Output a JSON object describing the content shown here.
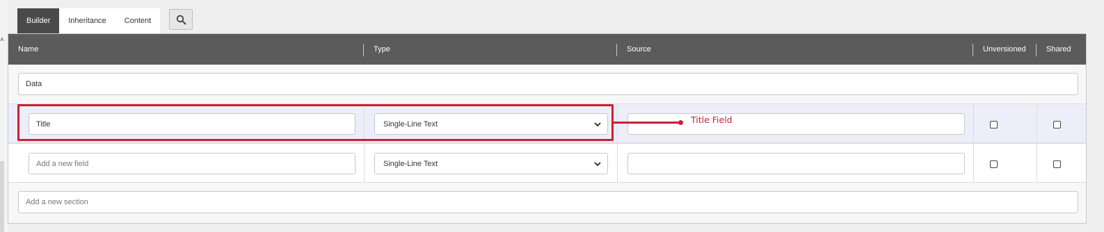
{
  "tabs": [
    {
      "label": "Builder",
      "active": true
    },
    {
      "label": "Inheritance",
      "active": false
    },
    {
      "label": "Content",
      "active": false
    }
  ],
  "search": {
    "icon": "search-icon"
  },
  "grid": {
    "columns": [
      "Name",
      "Type",
      "Source",
      "Unversioned",
      "Shared"
    ],
    "sections": [
      {
        "name": "Data",
        "fields": [
          {
            "name": "Title",
            "type": "Single-Line Text",
            "source": "",
            "unversioned": false,
            "shared": false
          },
          {
            "name_placeholder": "Add a new field",
            "type": "Single-Line Text",
            "source": "",
            "unversioned": false,
            "shared": false
          }
        ]
      }
    ],
    "new_section_placeholder": "Add a new section"
  },
  "annotation": {
    "label": "Title Field",
    "color": "#cc1f36"
  },
  "colors": {
    "header_bg": "#5b5b5b",
    "active_tab_bg": "#4a4a4a",
    "highlight_row": "#eeeefa"
  }
}
